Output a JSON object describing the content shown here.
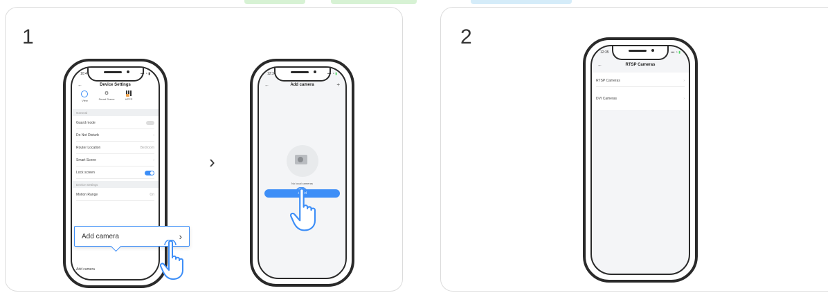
{
  "colors": {
    "accent": "#3d8ef7",
    "tab_green": "#d7f2d4",
    "tab_blue": "#d5ecf9"
  },
  "steps": [
    {
      "number": "1"
    },
    {
      "number": "2"
    }
  ],
  "next_arrow": "›",
  "phone_a": {
    "time": "10:47",
    "back": "←",
    "title": "Device Settings",
    "tabs": [
      "View",
      "Smart Scene",
      "UPPP"
    ],
    "sections": {
      "general": "General",
      "device_settings": "Device Settings"
    },
    "rows": [
      {
        "label": "Guard mode",
        "control": "toggle-off"
      },
      {
        "label": "Do Not Disturb",
        "control": "chevron"
      },
      {
        "label": "Router Location",
        "value": "Bedroom"
      },
      {
        "label": "Smart Scene",
        "control": "chevron"
      },
      {
        "label": "Lock screen",
        "control": "toggle-on"
      },
      {
        "label": "Motion Range",
        "value": "On"
      }
    ],
    "bottom_row": "Add camera",
    "callout_label": "Add camera",
    "callout_chevron": "›"
  },
  "phone_b": {
    "time": "12:34",
    "back": "←",
    "title": "Add camera",
    "empty_text": "No local cameras",
    "add_button": "+ Add"
  },
  "phone_c": {
    "time": "12:35",
    "back": "←",
    "title": "RTSP Cameras",
    "rows": [
      {
        "label": "RTSP Cameras"
      },
      {
        "label": "DVI Cameras"
      }
    ]
  }
}
